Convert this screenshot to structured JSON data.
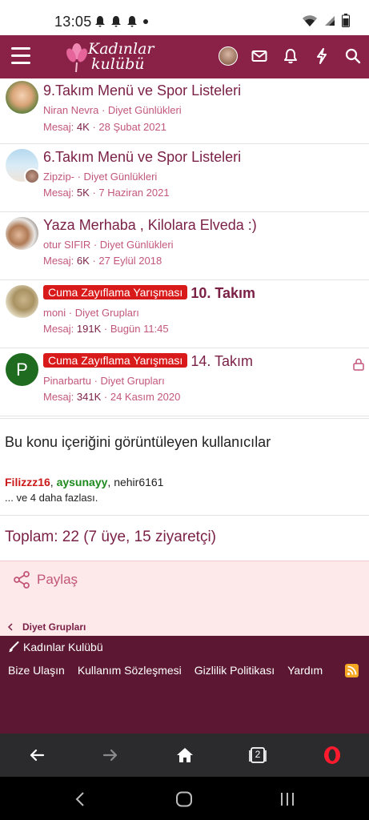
{
  "status_bar": {
    "time": "13:05"
  },
  "header": {
    "logo_line1": "Kadınlar",
    "logo_line2": "kulübü"
  },
  "threads": [
    {
      "prefix": "",
      "title": "9.Takım Menü ve Spor Listeleri",
      "meta": "Niran Nevra · Diyet Günlükleri",
      "stats_label": "Mesaj:",
      "messages": "4K",
      "date": "· 28 Şubat 2021"
    },
    {
      "prefix": "",
      "title": "6.Takım Menü ve Spor Listeleri",
      "meta": "Zipzip- · Diyet Günlükleri",
      "stats_label": "Mesaj:",
      "messages": "5K",
      "date": "· 7 Haziran 2021"
    },
    {
      "prefix": "",
      "title": "Yaza Merhaba , Kilolara Elveda :)",
      "meta": "otur SIFIR · Diyet Günlükleri",
      "stats_label": "Mesaj:",
      "messages": "6K",
      "date": "· 27 Eylül 2018"
    },
    {
      "prefix": "Cuma Zayıflama Yarışması",
      "title": "10. Takım",
      "meta": "moni · Diyet Grupları",
      "stats_label": "Mesaj:",
      "messages": "191K",
      "date": "· Bugün 11:45"
    },
    {
      "prefix": "Cuma Zayıflama Yarışması",
      "title": "14. Takım",
      "meta": "Pinarbartu · Diyet Grupları",
      "stats_label": "Mesaj:",
      "messages": "341K",
      "date": "· 24 Kasım 2020",
      "avatar_letter": "P"
    }
  ],
  "viewers": {
    "title": "Bu konu içeriğini görüntüleyen kullanıcılar",
    "user1": "Filizzz16",
    "user2": "aysunayy",
    "user3": "nehir6161",
    "more": "... ve 4 daha fazlası."
  },
  "total": "Toplam: 22 (7 üye, 15 ziyaretçi)",
  "share_label": "Paylaş",
  "breadcrumb": "Diyet Grupları",
  "footer": {
    "brand": "Kadınlar Kulübü",
    "links": [
      "Bize Ulaşın",
      "Kullanım Sözleşmesi",
      "Gizlilik Politikası",
      "Yardım"
    ]
  },
  "browser": {
    "tab_count": "2"
  },
  "colors": {
    "brand": "#8a2247",
    "footer": "#5c1832",
    "prefix_bg": "#d91a1a",
    "link": "#c2577a"
  }
}
